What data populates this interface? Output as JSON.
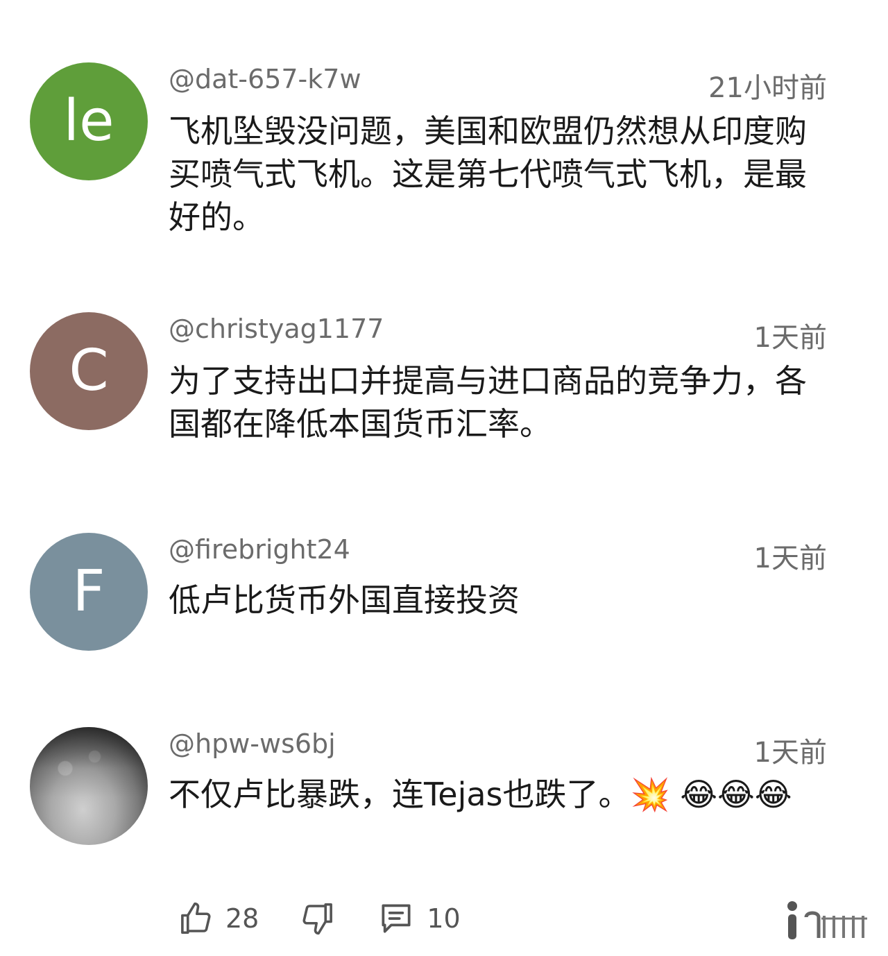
{
  "comments": [
    {
      "avatar_text": "le",
      "avatar_color": "#5f9e3a",
      "handle": "@dat-657-k7w",
      "time": "21小时前",
      "text": "飞机坠毁没问题，美国和欧盟仍然想从印度购买喷气式飞机。这是第七代喷气式飞机，是最好的。"
    },
    {
      "avatar_text": "C",
      "avatar_color": "#8c6b62",
      "handle": "@christyag1177",
      "time": "1天前",
      "text": "为了支持出口并提高与进口商品的竞争力，各国都在降低本国货币汇率。"
    },
    {
      "avatar_text": "F",
      "avatar_color": "#7a909d",
      "handle": "@firebright24",
      "time": "1天前",
      "text": "低卢比货币外国直接投资"
    },
    {
      "avatar_text": "",
      "avatar_color": "#8a8a8a",
      "handle": "@hpw-ws6bj",
      "time": "1天前",
      "text": "不仅卢比暴跌，连Tejas也跌了。💥 😂😂😂"
    }
  ],
  "actions": {
    "like_count": "28",
    "reply_count": "10",
    "like_icon": "thumbs-up-icon",
    "dislike_icon": "thumbs-down-icon",
    "reply_icon": "comment-icon"
  }
}
